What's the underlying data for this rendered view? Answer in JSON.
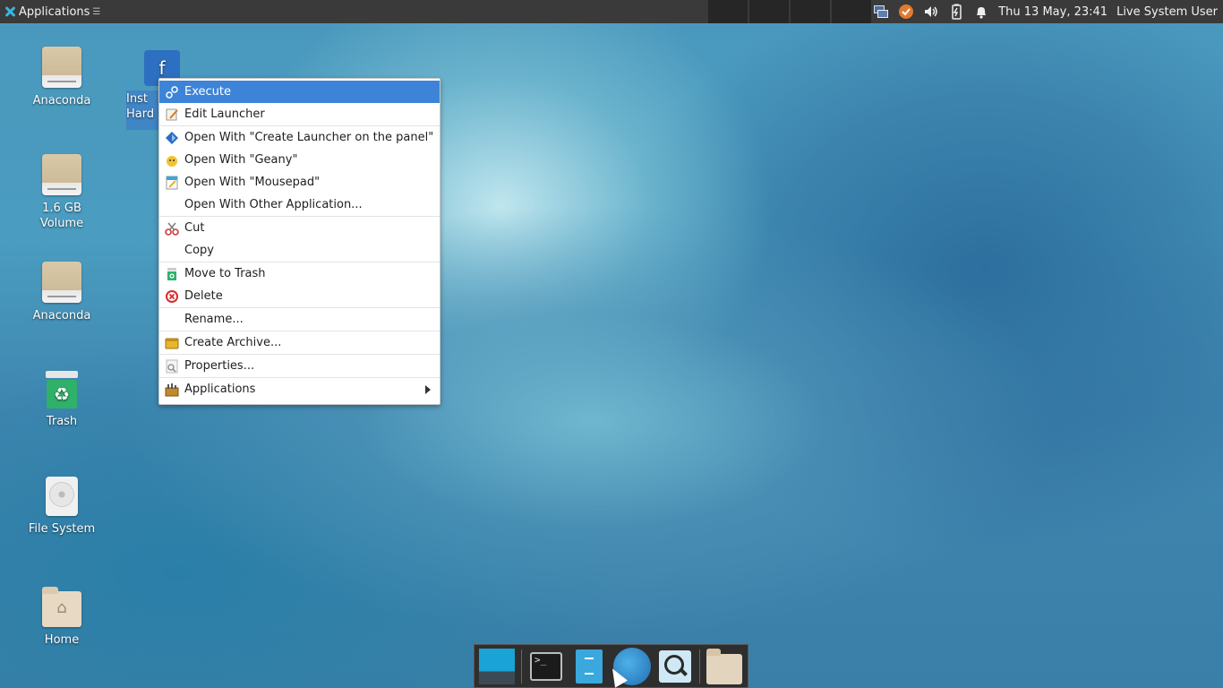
{
  "top_panel": {
    "apps_label": "Applications",
    "apps_glyph": "☰",
    "clock": "Thu 13 May, 23:41",
    "user": "Live System User",
    "tray_icons": [
      "network-icon",
      "update-icon",
      "volume-icon",
      "battery-icon",
      "notification-bell-icon"
    ]
  },
  "desktop": {
    "icons": [
      {
        "label": "Anaconda",
        "type": "drive"
      },
      {
        "label": "Inst Hard",
        "type": "launcher-selected"
      },
      {
        "label": "1.6 GB Volume",
        "type": "drive"
      },
      {
        "label": "Anaconda",
        "type": "drive"
      },
      {
        "label": "Trash",
        "type": "trash"
      },
      {
        "label": "File System",
        "type": "hdd"
      },
      {
        "label": "Home",
        "type": "home"
      }
    ]
  },
  "context_menu": {
    "items": [
      {
        "label": "Execute",
        "icon": "execute-icon",
        "active": true
      },
      {
        "label": "Edit Launcher",
        "icon": "edit-icon"
      },
      {
        "label": "Open With \"Create Launcher on the panel\"",
        "icon": "launcher-icon"
      },
      {
        "label": "Open With \"Geany\"",
        "icon": "geany-icon"
      },
      {
        "label": "Open With \"Mousepad\"",
        "icon": "mousepad-icon"
      },
      {
        "label": "Open With Other Application...",
        "icon": ""
      },
      {
        "label": "Cut",
        "icon": "scissors-icon"
      },
      {
        "label": "Copy",
        "icon": ""
      },
      {
        "label": "Move to Trash",
        "icon": "trash-icon"
      },
      {
        "label": "Delete",
        "icon": "delete-icon"
      },
      {
        "label": "Rename...",
        "icon": ""
      },
      {
        "label": "Create Archive...",
        "icon": "archive-icon"
      },
      {
        "label": "Properties...",
        "icon": "properties-icon"
      },
      {
        "label": "Applications",
        "icon": "applications-icon",
        "submenu": true
      }
    ]
  },
  "dock": {
    "items": [
      "show-desktop-icon",
      "terminal-icon",
      "file-manager-icon",
      "web-browser-icon",
      "app-finder-icon",
      "folder-icon"
    ],
    "terminal_prompt": ">_"
  }
}
